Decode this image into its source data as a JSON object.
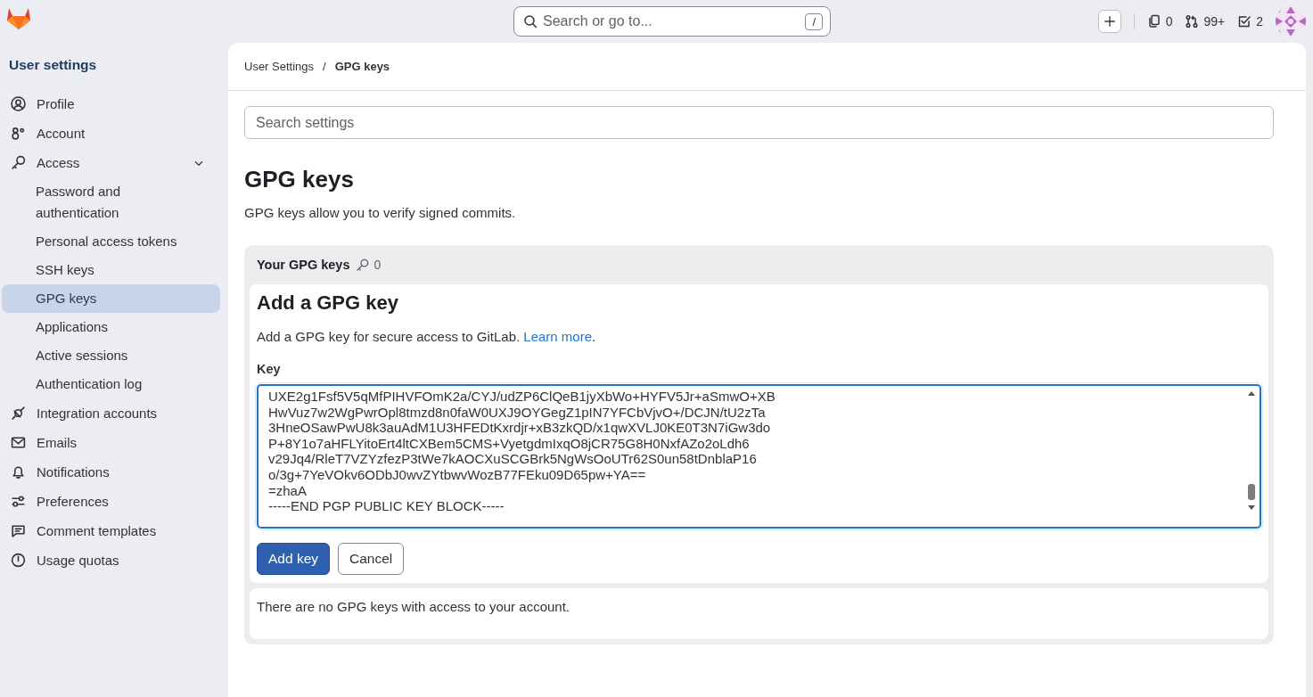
{
  "topbar": {
    "search": {
      "placeholder": "Search or go to...",
      "shortcut": "/"
    },
    "counters": [
      {
        "kind": "snippets",
        "count": "0"
      },
      {
        "kind": "merge-requests",
        "count": "99+"
      },
      {
        "kind": "todos",
        "count": "2"
      }
    ]
  },
  "sidebar": {
    "title": "User settings",
    "items": [
      {
        "kind": "profile",
        "label": "Profile",
        "selected": false
      },
      {
        "kind": "account",
        "label": "Account",
        "selected": false
      },
      {
        "kind": "access",
        "label": "Access",
        "selected": false,
        "expanded": true,
        "children": [
          {
            "label": "Password and authentication",
            "selected": false
          },
          {
            "label": "Personal access tokens",
            "selected": false
          },
          {
            "label": "SSH keys",
            "selected": false
          },
          {
            "label": "GPG keys",
            "selected": true
          },
          {
            "label": "Applications",
            "selected": false
          },
          {
            "label": "Active sessions",
            "selected": false
          },
          {
            "label": "Authentication log",
            "selected": false
          }
        ]
      },
      {
        "kind": "integrations",
        "label": "Integration accounts",
        "selected": false
      },
      {
        "kind": "emails",
        "label": "Emails",
        "selected": false
      },
      {
        "kind": "notifications",
        "label": "Notifications",
        "selected": false
      },
      {
        "kind": "preferences",
        "label": "Preferences",
        "selected": false
      },
      {
        "kind": "comments",
        "label": "Comment templates",
        "selected": false
      },
      {
        "kind": "quotas",
        "label": "Usage quotas",
        "selected": false
      }
    ]
  },
  "breadcrumb": {
    "items": [
      "User Settings",
      "GPG keys"
    ],
    "separator": "/"
  },
  "settings_search": {
    "placeholder": "Search settings"
  },
  "page": {
    "title": "GPG keys",
    "description": "GPG keys allow you to verify signed commits."
  },
  "keys_card": {
    "title": "Your GPG keys",
    "count": "0",
    "form": {
      "title": "Add a GPG key",
      "description": "Add a GPG key for secure access to GitLab.",
      "link": "Learn more",
      "link_tail": ".",
      "key_label": "Key",
      "key_value": [
        "UXE2g1Fsf5V5qMfPIHVFOmK2a/CYJ/udZP6ClQeB1jyXbWo+HYFV5Jr+aSmwO+XB",
        "HwVuz7w2WgPwrOpl8tmzd8n0faW0UXJ9OYGegZ1pIN7YFCbVjvO+/DCJN/tU2zTa",
        "3HneOSawPwU8k3auAdM1U3HFEDtKxrdjr+xB3zkQD/x1qwXVLJ0KE0T3N7iGw3do",
        "P+8Y1o7aHFLYitoErt4ltCXBem5CMS+VyetgdmIxqO8jCR75G8H0NxfAZo2oLdh6",
        "v29Jq4/RleT7VZYzfezP3tWe7kAOCXuSCGBrk5NgWsOoUTr62S0un58tDnblaP16",
        "o/3g+7YeVOkv6ODbJ0wvZYtbwvWozB77FEku09D65pw+YA==",
        "=zhaA",
        "-----END PGP PUBLIC KEY BLOCK-----"
      ],
      "buttons": [
        {
          "kind": "primary",
          "label": "Add key"
        },
        {
          "kind": "secondary",
          "label": "Cancel"
        }
      ]
    },
    "empty_text": "There are no GPG keys with access to your account."
  }
}
